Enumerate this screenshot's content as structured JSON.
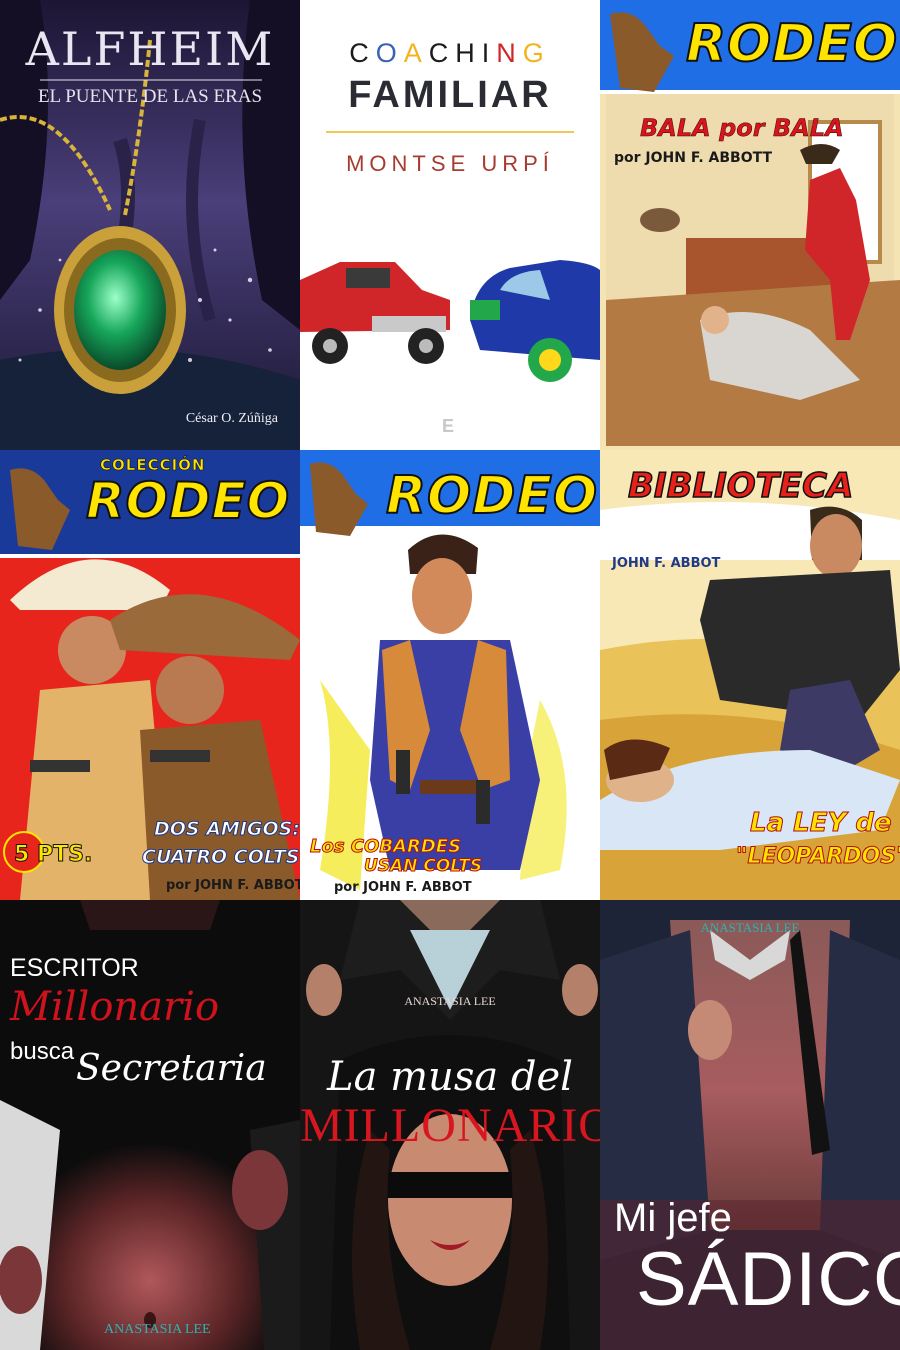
{
  "covers": [
    {
      "id": "alfheim",
      "title": "ALFHEIM",
      "subtitle": "EL PUENTE DE LAS ERAS",
      "author": "César O. Zúñiga",
      "colors": {
        "background": "#231a3c",
        "gem": "#16a65a",
        "chain": "#d7b43a"
      }
    },
    {
      "id": "coaching-familiar",
      "title_line1": "COACHING",
      "title_line2": "FAMILIAR",
      "author": "MONTSE URPÍ",
      "publisher_mark": "E",
      "colors": {
        "c": "#1b1b1b",
        "o": "#3a62b5",
        "a": "#f2b41c",
        "line": "#f2c75a",
        "author": "#a83b30"
      }
    },
    {
      "id": "rodeo-bala-por-bala",
      "series": "RODEO",
      "title": "BALA por BALA",
      "author": "por JOHN F. ABBOTT",
      "colors": {
        "banner": "#1f6ee6",
        "series": "#ffe400",
        "title": "#d8151d"
      }
    },
    {
      "id": "rodeo-dos-amigos",
      "collection": "COLECCIÓN",
      "series": "RODEO",
      "title_line1": "DOS AMIGOS:",
      "title_line2": "CUATRO COLTS",
      "author": "por JOHN F. ABBOT",
      "price": "5 PTS.",
      "colors": {
        "banner": "#1a3a9a",
        "background": "#e8251c"
      }
    },
    {
      "id": "rodeo-los-cobardes",
      "series": "RODEO",
      "title_line1": "Los COBARDES",
      "title_line2": "USAN COLTS",
      "author": "por JOHN F. ABBOT",
      "colors": {
        "banner": "#1f6ee6"
      }
    },
    {
      "id": "biblioteca-la-ley",
      "series": "BIBLIOTECA",
      "author": "JOHN F. ABBOT",
      "title_line1": "La LEY de los",
      "title_line2": "\"LEOPARDOS\"",
      "colors": {
        "series": "#e8201a"
      }
    },
    {
      "id": "escritor-millonario",
      "line1": "ESCRITOR",
      "line2": "Millonario",
      "line3": "busca",
      "line4": "Secretaria",
      "author": "ANASTASIA LEE",
      "colors": {
        "accent": "#d0121d",
        "author": "#2fb2b0"
      }
    },
    {
      "id": "la-musa-del-millonario",
      "author": "ANASTASIA LEE",
      "title_line1": "La musa del",
      "title_line2": "MILLONARIO",
      "colors": {
        "accent": "#d7161f"
      }
    },
    {
      "id": "mi-jefe-sadico",
      "author": "ANASTASIA LEE",
      "title_line1": "Mi jefe",
      "title_line2": "SÁDICO",
      "colors": {
        "author": "#2fb2b0"
      }
    }
  ]
}
